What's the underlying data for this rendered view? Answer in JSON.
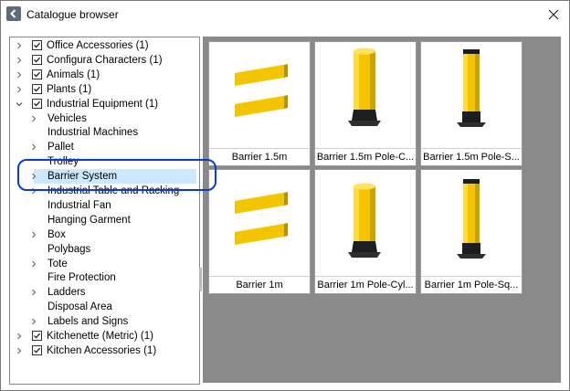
{
  "window": {
    "title": "Catalogue browser"
  },
  "tree": {
    "items": [
      {
        "label": "Office Accessories (1)",
        "checkbox": true,
        "expander": "collapsed",
        "level": 0
      },
      {
        "label": "Configura Characters (1)",
        "checkbox": true,
        "expander": "collapsed",
        "level": 0
      },
      {
        "label": "Animals (1)",
        "checkbox": true,
        "expander": "collapsed",
        "level": 0
      },
      {
        "label": "Plants (1)",
        "checkbox": true,
        "expander": "collapsed",
        "level": 0
      },
      {
        "label": "Industrial Equipment (1)",
        "checkbox": true,
        "expander": "expanded",
        "level": 0
      },
      {
        "label": "Vehicles",
        "checkbox": false,
        "expander": "collapsed",
        "level": 1
      },
      {
        "label": "Industrial Machines",
        "checkbox": false,
        "expander": "none",
        "level": 1
      },
      {
        "label": "Pallet",
        "checkbox": false,
        "expander": "collapsed",
        "level": 1
      },
      {
        "label": "Trolley",
        "checkbox": false,
        "expander": "none",
        "level": 1
      },
      {
        "label": "Barrier System",
        "checkbox": false,
        "expander": "collapsed",
        "level": 1,
        "selected": true
      },
      {
        "label": "Industrial Table and Racking",
        "checkbox": false,
        "expander": "collapsed",
        "level": 1
      },
      {
        "label": "Industrial Fan",
        "checkbox": false,
        "expander": "none",
        "level": 1
      },
      {
        "label": "Hanging Garment",
        "checkbox": false,
        "expander": "none",
        "level": 1
      },
      {
        "label": "Box",
        "checkbox": false,
        "expander": "collapsed",
        "level": 1
      },
      {
        "label": "Polybags",
        "checkbox": false,
        "expander": "none",
        "level": 1
      },
      {
        "label": "Tote",
        "checkbox": false,
        "expander": "collapsed",
        "level": 1
      },
      {
        "label": "Fire Protection",
        "checkbox": false,
        "expander": "none",
        "level": 1
      },
      {
        "label": "Ladders",
        "checkbox": false,
        "expander": "collapsed",
        "level": 1
      },
      {
        "label": "Disposal Area",
        "checkbox": false,
        "expander": "none",
        "level": 1
      },
      {
        "label": "Labels and Signs",
        "checkbox": false,
        "expander": "collapsed",
        "level": 1
      },
      {
        "label": "Kitchenette (Metric) (1)",
        "checkbox": true,
        "expander": "collapsed",
        "level": 0
      },
      {
        "label": "Kitchen Accessories (1)",
        "checkbox": true,
        "expander": "collapsed",
        "level": 0
      }
    ]
  },
  "gallery": {
    "tiles": [
      {
        "caption": "Barrier 1.5m",
        "thumb": "barrier-rails"
      },
      {
        "caption": "Barrier 1.5m Pole-C...",
        "thumb": "pole-cylinder"
      },
      {
        "caption": "Barrier 1.5m Pole-S...",
        "thumb": "pole-square"
      },
      {
        "caption": "Barrier 1m",
        "thumb": "barrier-rails"
      },
      {
        "caption": "Barrier 1m Pole-Cyl...",
        "thumb": "pole-cylinder"
      },
      {
        "caption": "Barrier 1m Pole-Sq...",
        "thumb": "pole-square"
      }
    ]
  },
  "colors": {
    "accent_highlight": "#0b3bd6",
    "selection": "#cce8ff",
    "barrier_yellow": "#f2c500",
    "barrier_black": "#1e1e1e",
    "gallery_bg": "#8a8a8a"
  }
}
